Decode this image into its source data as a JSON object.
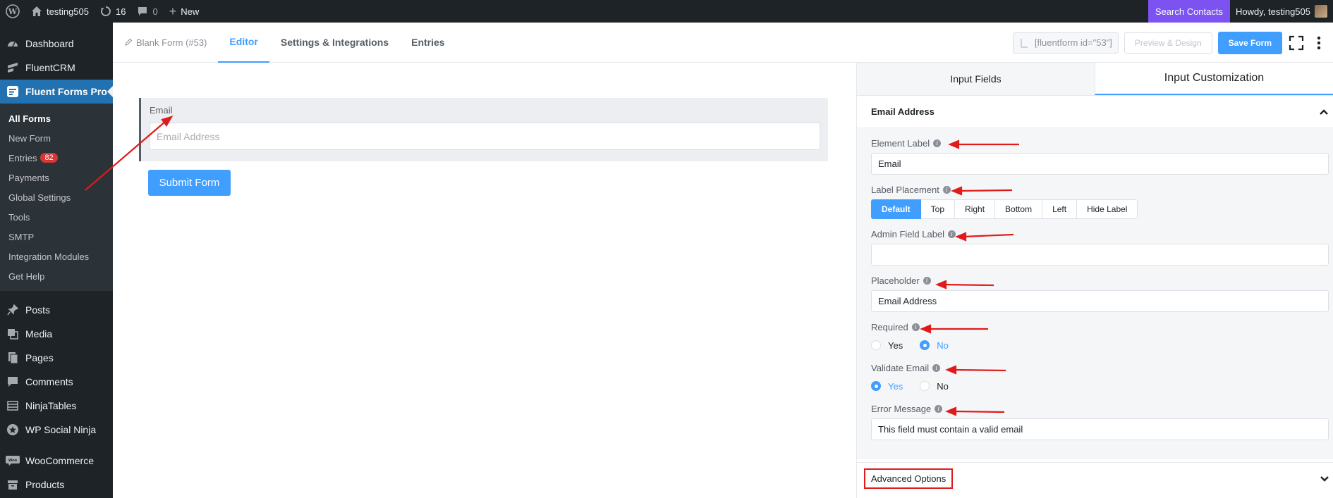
{
  "adminbar": {
    "site_name": "testing505",
    "updates_count": "16",
    "comments_count": "0",
    "new_label": "New",
    "search_contacts": "Search Contacts",
    "howdy": "Howdy, testing505"
  },
  "sidebar": {
    "top_items": [
      {
        "label": "Dashboard",
        "icon": "dashboard-icon"
      },
      {
        "label": "FluentCRM",
        "icon": "fluentcrm-icon"
      },
      {
        "label": "Fluent Forms Pro",
        "icon": "fluentforms-icon"
      }
    ],
    "submenu": [
      {
        "label": "All Forms"
      },
      {
        "label": "New Form"
      },
      {
        "label": "Entries",
        "badge": "82"
      },
      {
        "label": "Payments"
      },
      {
        "label": "Global Settings"
      },
      {
        "label": "Tools"
      },
      {
        "label": "SMTP"
      },
      {
        "label": "Integration Modules"
      },
      {
        "label": "Get Help"
      }
    ],
    "lower_items": [
      {
        "label": "Posts",
        "icon": "pin-icon"
      },
      {
        "label": "Media",
        "icon": "media-icon"
      },
      {
        "label": "Pages",
        "icon": "pages-icon"
      },
      {
        "label": "Comments",
        "icon": "comment-icon"
      },
      {
        "label": "NinjaTables",
        "icon": "table-icon"
      },
      {
        "label": "WP Social Ninja",
        "icon": "star-icon"
      },
      {
        "label": "WooCommerce",
        "icon": "woo-icon"
      },
      {
        "label": "Products",
        "icon": "archive-icon"
      }
    ]
  },
  "topnav": {
    "breadcrumb": "Blank Form (#53)",
    "tabs": [
      "Editor",
      "Settings & Integrations",
      "Entries"
    ],
    "shortcode": "[fluentform id=\"53\"]",
    "preview_label": "Preview & Design",
    "save_label": "Save Form"
  },
  "canvas": {
    "field_label": "Email",
    "field_placeholder": "Email Address",
    "submit_label": "Submit Form"
  },
  "panel": {
    "tabs": [
      "Input Fields",
      "Input Customization"
    ],
    "section_title": "Email Address",
    "element_label": {
      "label": "Element Label",
      "value": "Email"
    },
    "label_placement": {
      "label": "Label Placement",
      "options": [
        "Default",
        "Top",
        "Right",
        "Bottom",
        "Left",
        "Hide Label"
      ],
      "selected": "Default"
    },
    "admin_field_label": {
      "label": "Admin Field Label",
      "value": ""
    },
    "placeholder": {
      "label": "Placeholder",
      "value": "Email Address"
    },
    "required": {
      "label": "Required",
      "options": [
        "Yes",
        "No"
      ],
      "selected": "No"
    },
    "validate_email": {
      "label": "Validate Email",
      "options": [
        "Yes",
        "No"
      ],
      "selected": "Yes"
    },
    "error_message": {
      "label": "Error Message",
      "value": "This field must contain a valid email"
    },
    "advanced_options": "Advanced Options"
  },
  "colors": {
    "accent": "#409eff",
    "wp_blue": "#2271b1",
    "annotation_red": "#e01b1b",
    "search_purple": "#7c53f0"
  }
}
